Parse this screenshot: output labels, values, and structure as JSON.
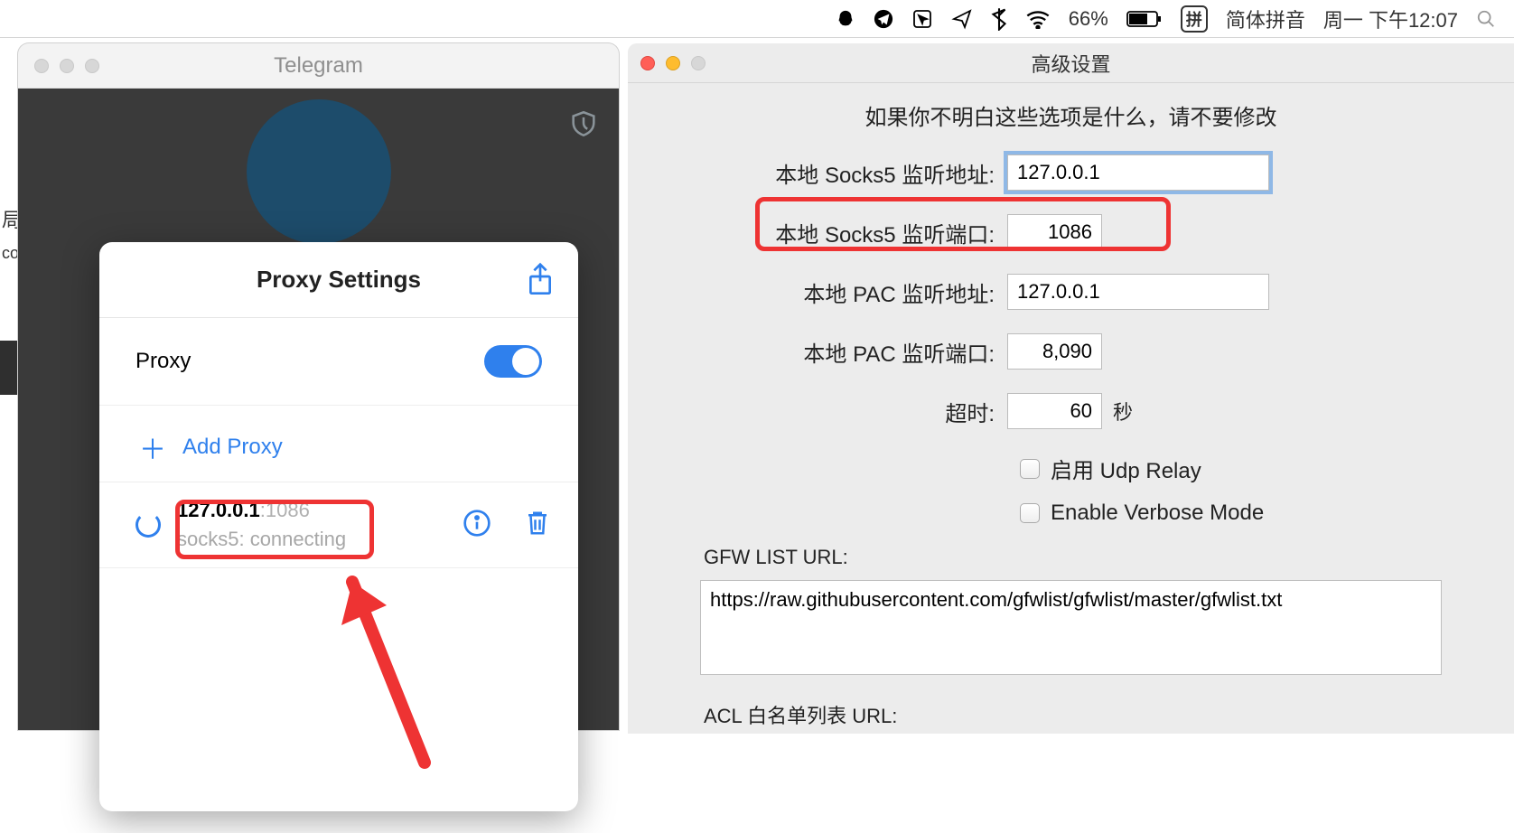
{
  "menubar": {
    "battery_percent": "66%",
    "ime_box": "拼",
    "ime_label": "简体拼音",
    "clock": "周一 下午12:07"
  },
  "telegram": {
    "title": "Telegram",
    "popover_title": "Proxy Settings",
    "proxy_label": "Proxy",
    "add_label": "Add Proxy",
    "entry_ip": "127.0.0.1",
    "entry_port": ":1086",
    "entry_status": "socks5: connecting"
  },
  "partial": {
    "a": "局",
    "b": "co"
  },
  "adv": {
    "title": "高级设置",
    "warning": "如果你不明白这些选项是什么，请不要修改",
    "socks_addr_label": "本地 Socks5 监听地址:",
    "socks_addr": "127.0.0.1",
    "socks_port_label": "本地 Socks5 监听端口:",
    "socks_port": "1086",
    "pac_addr_label": "本地 PAC 监听地址:",
    "pac_addr": "127.0.0.1",
    "pac_port_label": "本地 PAC 监听端口:",
    "pac_port": "8,090",
    "timeout_label": "超时:",
    "timeout_val": "60",
    "timeout_suffix": "秒",
    "udp_label": "启用 Udp Relay",
    "verbose_label": "Enable Verbose Mode",
    "gfw_label": "GFW LIST URL:",
    "gfw_url": "https://raw.githubusercontent.com/gfwlist/gfwlist/master/gfwlist.txt",
    "acl_label": "ACL 白名单列表 URL:"
  }
}
